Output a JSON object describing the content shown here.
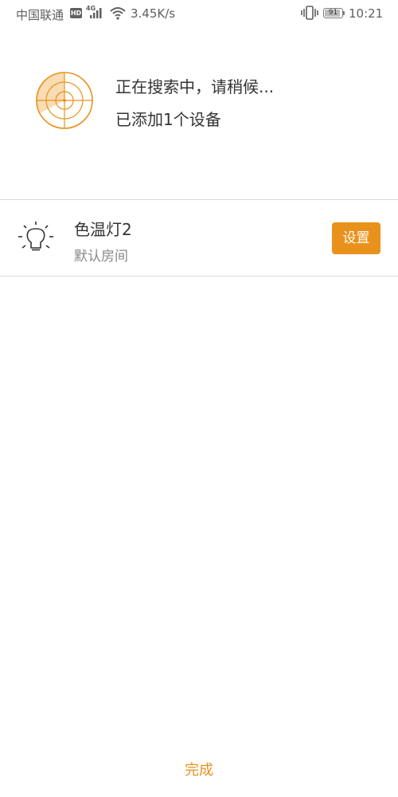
{
  "status_bar": {
    "carrier": "中国联通",
    "hd_badge": "HD",
    "network_type": "4G",
    "speed": "3.45K/s",
    "battery_level": "91",
    "time": "10:21",
    "icons": [
      "hd-icon",
      "signal-icon",
      "wifi-icon",
      "vibrate-icon",
      "battery-icon"
    ]
  },
  "search": {
    "status_text": "正在搜索中，请稍候...",
    "added_text": "已添加1个设备",
    "icon": "radar-icon"
  },
  "devices": [
    {
      "name": "色温灯2",
      "room": "默认房间",
      "icon": "bulb-icon",
      "action_label": "设置"
    }
  ],
  "footer": {
    "done_label": "完成"
  },
  "colors": {
    "accent": "#e9921b",
    "radar_fill": "#f7d6a6",
    "divider": "#d9d9d9",
    "text_primary": "#333333",
    "text_secondary": "#888888"
  }
}
